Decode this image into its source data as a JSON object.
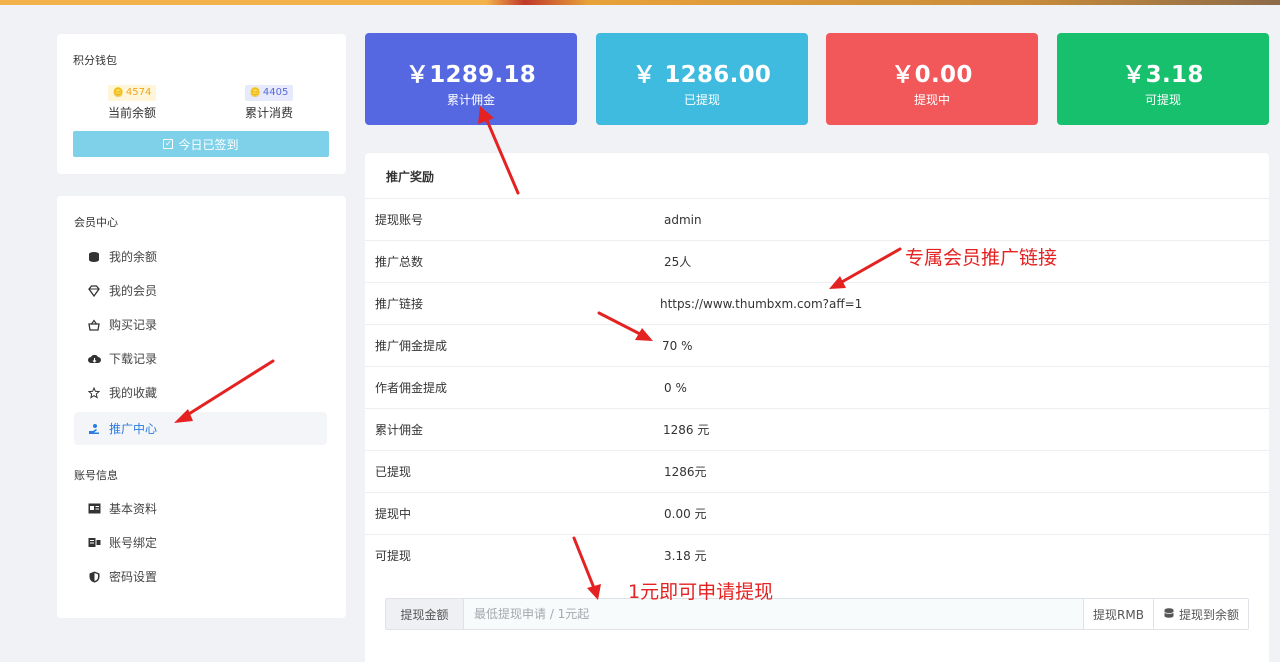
{
  "wallet": {
    "title": "积分钱包",
    "balance_value": "4574",
    "balance_label": "当前余额",
    "spent_value": "4405",
    "spent_label": "累计消费",
    "signin_label": "今日已签到"
  },
  "sidebar": {
    "member_section": "会员中心",
    "member_items": [
      {
        "label": "我的余额",
        "icon": "wallet-icon"
      },
      {
        "label": "我的会员",
        "icon": "diamond-icon"
      },
      {
        "label": "购买记录",
        "icon": "basket-icon"
      },
      {
        "label": "下载记录",
        "icon": "cloud-download-icon"
      },
      {
        "label": "我的收藏",
        "icon": "star-icon"
      },
      {
        "label": "推广中心",
        "icon": "share-icon",
        "active": true
      }
    ],
    "account_section": "账号信息",
    "account_items": [
      {
        "label": "基本资料",
        "icon": "id-card-icon"
      },
      {
        "label": "账号绑定",
        "icon": "link-icon"
      },
      {
        "label": "密码设置",
        "icon": "shield-icon"
      }
    ]
  },
  "tiles": [
    {
      "amount": "￥1289.18",
      "label": "累计佣金",
      "color": "#5667e2"
    },
    {
      "amount": "￥ 1286.00",
      "label": "已提现",
      "color": "#3fbbe0"
    },
    {
      "amount": "￥0.00",
      "label": "提现中",
      "color": "#f2575a"
    },
    {
      "amount": "￥3.18",
      "label": "可提现",
      "color": "#16c06d"
    }
  ],
  "panel": {
    "title": "推广奖励",
    "rows": [
      {
        "key": "提现账号",
        "value": "admin"
      },
      {
        "key": "推广总数",
        "value": "25人"
      },
      {
        "key": "推广链接",
        "value": "https://www.thumbxm.com?aff=1"
      },
      {
        "key": "推广佣金提成",
        "value": "70 %"
      },
      {
        "key": "作者佣金提成",
        "value": "0 %"
      },
      {
        "key": "累计佣金",
        "value": "1286 元"
      },
      {
        "key": "已提现",
        "value": "1286元"
      },
      {
        "key": "提现中",
        "value": "0.00 元"
      },
      {
        "key": "可提现",
        "value": "3.18 元"
      }
    ],
    "withdraw": {
      "label": "提现金额",
      "placeholder": "最低提现申请 / 1元起",
      "rmb_button": "提现RMB",
      "balance_button": "提现到余额"
    }
  },
  "annotations": {
    "link_note": "专属会员推广链接",
    "min_note": "1元即可申请提现"
  },
  "colors": {
    "accent": "#2a7de1",
    "annotation": "#e52222"
  }
}
